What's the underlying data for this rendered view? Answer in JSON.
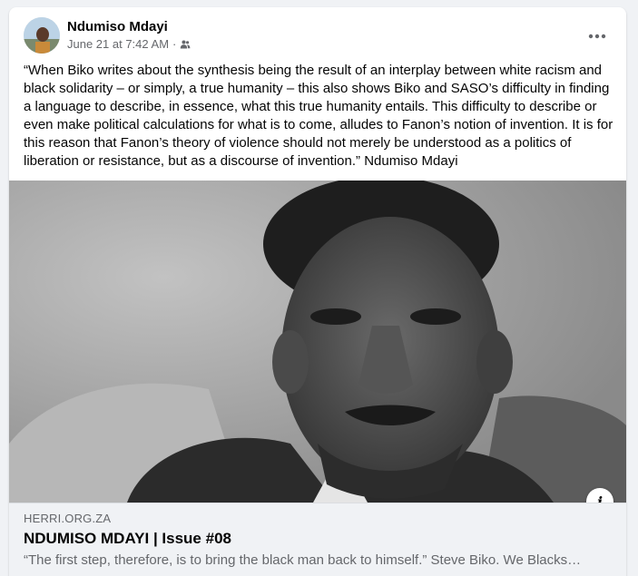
{
  "post": {
    "author": "Ndumiso Mdayi",
    "date": "June 21 at 7:42 AM",
    "separator": "·",
    "audience_icon": "friends-icon",
    "more_icon": "more-horizontal-icon",
    "text": "“When Biko writes about the synthesis being the result of an interplay between white racism and black solidarity – or simply, a true humanity – this also shows Biko and SASO’s difficulty in finding a language to describe, in essence, what this true humanity entails. This difficulty to describe or even make political calculations for what is to come, alludes to Fanon’s notion of invention. It is for this reason that Fanon’s theory of violence should not merely be understood as a politics of liberation or resistance, but as a discourse of invention.” Ndumiso Mdayi"
  },
  "link": {
    "domain": "HERRI.ORG.ZA",
    "title": "NDUMISO MDAYI | Issue #08",
    "description": "“The first step, therefore, is to bring the black man back to himself.” Steve Biko. We Blacks…",
    "info_label": "i"
  },
  "colors": {
    "background": "#f0f2f5",
    "card": "#ffffff",
    "primary_text": "#050505",
    "secondary_text": "#65676b"
  }
}
